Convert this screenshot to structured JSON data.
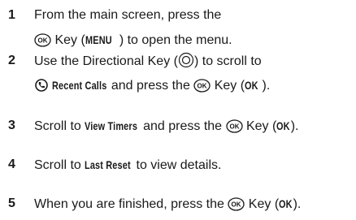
{
  "steps": [
    {
      "number": "1",
      "line1": "From the main screen, press the",
      "line2_key": " Key (",
      "line2_cmd": "MENU",
      "line2_end": ") to open the menu."
    },
    {
      "number": "2",
      "line1_a": "Use the Directional Key (",
      "line1_b": ") to scroll to",
      "line2_cmd": "Recent Calls",
      "line2_mid": " and press the ",
      "line2_key": " Key (",
      "line2_ok": "OK",
      "line2_end": ")."
    },
    {
      "number": "3",
      "a": "Scroll to ",
      "cmd": "View Timers",
      "b": " and press the ",
      "c": " Key (",
      "ok": "OK",
      "end": ")."
    },
    {
      "number": "4",
      "a": "Scroll to ",
      "cmd": "Last Reset",
      "b": " to view details."
    },
    {
      "number": "5",
      "a": "When you are finished, press the ",
      "c": " Key (",
      "ok": "OK",
      "end": ")."
    }
  ],
  "icons": {
    "ok_key": "ok-key-icon",
    "directional_key": "directional-key-icon",
    "recent_calls": "recent-calls-icon"
  }
}
